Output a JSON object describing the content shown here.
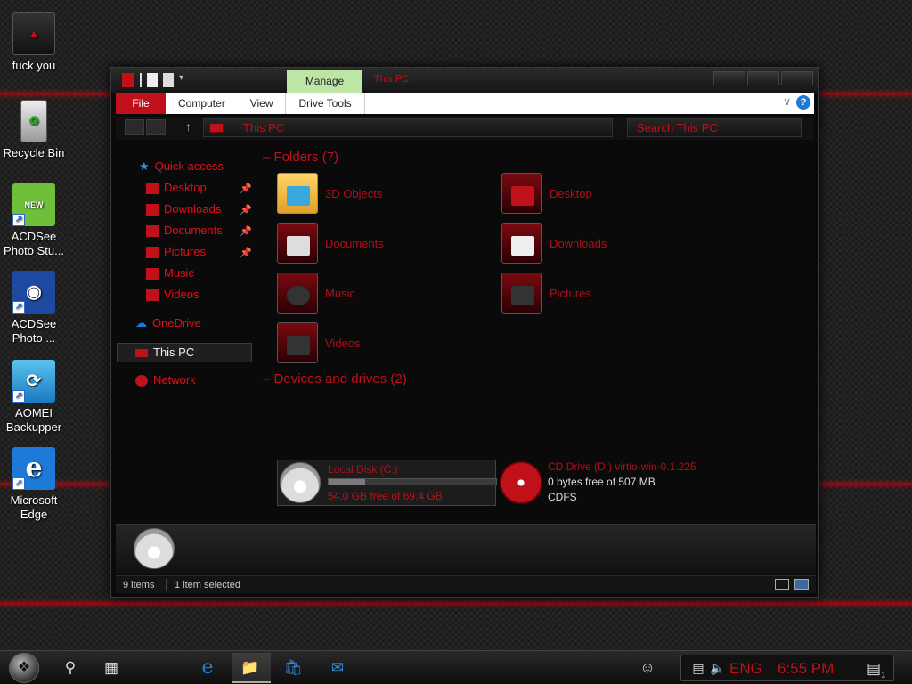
{
  "desktop": {
    "icons": [
      {
        "label": "fuck you"
      },
      {
        "label": "Recycle Bin"
      },
      {
        "label": "ACDSee Photo Stu..."
      },
      {
        "label": "ACDSee Photo ..."
      },
      {
        "label": "AOMEI Backupper"
      },
      {
        "label": "Microsoft Edge"
      }
    ]
  },
  "window": {
    "title": "This PC",
    "manage_tab": "Manage",
    "ribbon": {
      "file": "File",
      "computer": "Computer",
      "view": "View",
      "drive_tools": "Drive Tools",
      "help": "?"
    },
    "address": "This PC",
    "search_placeholder": "Search This PC"
  },
  "nav": {
    "quick_access": "Quick access",
    "items": [
      {
        "label": "Desktop",
        "pinned": true
      },
      {
        "label": "Downloads",
        "pinned": true
      },
      {
        "label": "Documents",
        "pinned": true
      },
      {
        "label": "Pictures",
        "pinned": true
      },
      {
        "label": "Music",
        "pinned": false
      },
      {
        "label": "Videos",
        "pinned": false
      }
    ],
    "onedrive": "OneDrive",
    "this_pc": "This PC",
    "network": "Network"
  },
  "content": {
    "folders_header": "Folders (7)",
    "folders": [
      {
        "label": "3D Objects"
      },
      {
        "label": "Desktop"
      },
      {
        "label": "Documents"
      },
      {
        "label": "Downloads"
      },
      {
        "label": "Music"
      },
      {
        "label": "Pictures"
      },
      {
        "label": "Videos"
      }
    ],
    "drives_header": "Devices and drives (2)",
    "drives": [
      {
        "name": "Local Disk (C:)",
        "free": "54.0 GB free of 69.4 GB",
        "used_fraction": 0.22
      },
      {
        "name": "CD Drive (D:) virtio-win-0.1.225",
        "free": "0 bytes free of 507 MB",
        "fs": "CDFS"
      }
    ]
  },
  "status": {
    "items": "9 items",
    "selected": "1 item selected"
  },
  "taskbar": {
    "language": "ENG",
    "time": "6:55 PM",
    "notifications": "1"
  },
  "colors": {
    "accent": "#c0101a",
    "manage_tab": "#bde6a6",
    "background": "#1b1b1b"
  }
}
